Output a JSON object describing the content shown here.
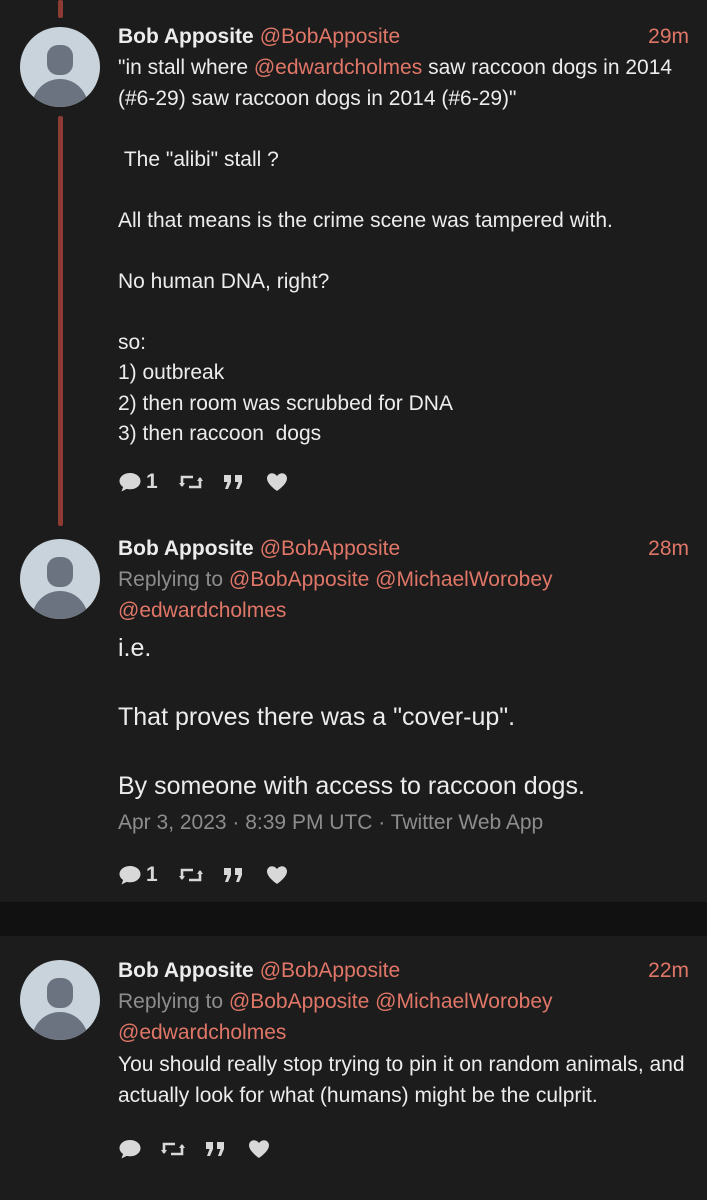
{
  "tweets": [
    {
      "name": "Bob Apposite",
      "handle": "@BobApposite",
      "time": "29m",
      "text_pre": "\"in stall where ",
      "text_mention": "@edwardcholmes",
      "text_post": " saw raccoon dogs in 2014 (#6-29) saw raccoon dogs in 2014 (#6-29)\"\n\n The \"alibi\" stall ?\n\nAll that means is the crime scene was tampered with.\n\nNo human DNA, right?\n\nso:\n1) outbreak\n2) then room was scrubbed for DNA\n3) then raccoon  dogs",
      "reply_count": "1",
      "icons": [
        "reply-icon",
        "retweet-icon",
        "quote-icon",
        "heart-icon"
      ]
    },
    {
      "name": "Bob Apposite",
      "handle": "@BobApposite",
      "time": "28m",
      "replying_label": "Replying to",
      "replying_mentions": [
        "@BobApposite",
        "@MichaelWorobey",
        "@edwardcholmes"
      ],
      "text": "i.e.\n\nThat proves there was a \"cover-up\".\n\nBy someone with access to raccoon dogs.",
      "meta": "Apr 3, 2023 · 8:39 PM UTC · Twitter Web App",
      "reply_count": "1",
      "icons": [
        "reply-icon",
        "retweet-icon",
        "quote-icon",
        "heart-icon"
      ]
    },
    {
      "name": "Bob Apposite",
      "handle": "@BobApposite",
      "time": "22m",
      "replying_label": "Replying to",
      "replying_mentions": [
        "@BobApposite",
        "@MichaelWorobey",
        "@edwardcholmes"
      ],
      "text": "You should really stop trying to pin it on random animals, and actually look for what (humans) might be the culprit.",
      "reply_count": "",
      "icons": [
        "reply-icon",
        "retweet-icon",
        "quote-icon",
        "heart-icon"
      ]
    }
  ],
  "colors": {
    "background": "#1c1c1c",
    "accent": "#e07667",
    "thread_line": "#8e3b34",
    "muted": "#8d8d8d"
  }
}
